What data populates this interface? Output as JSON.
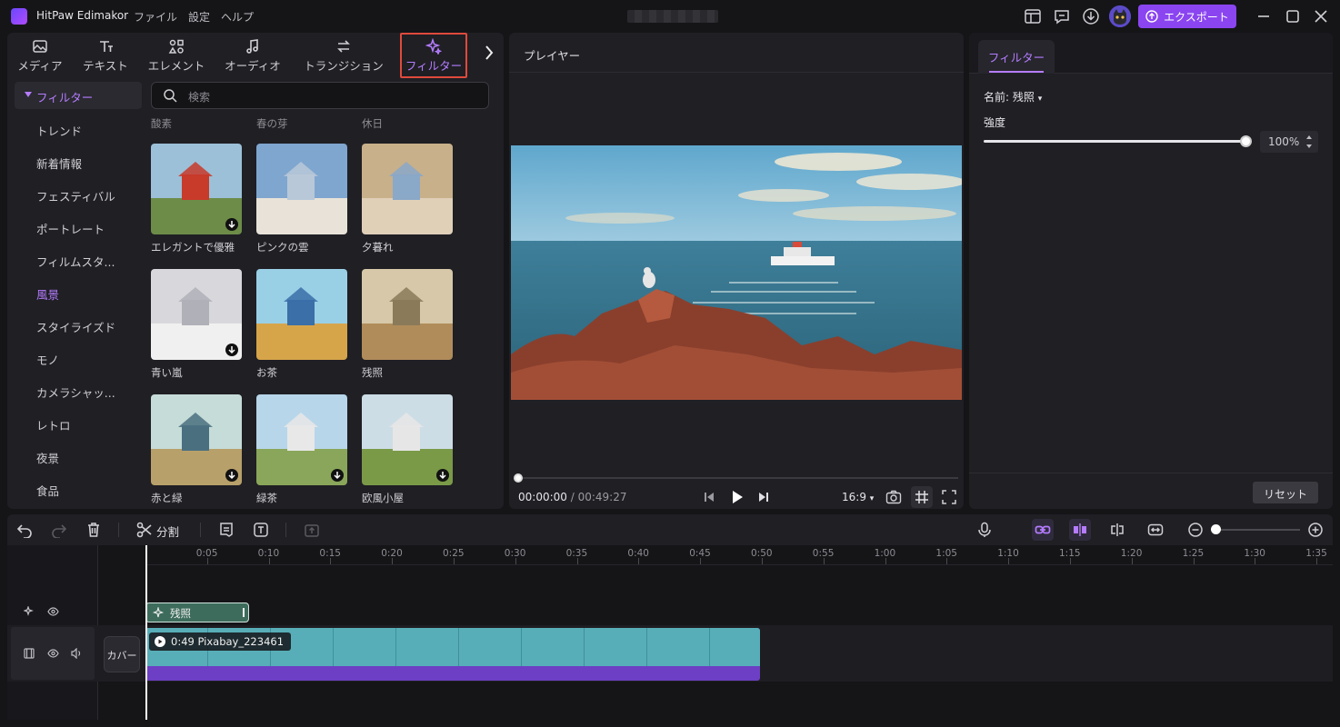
{
  "app": {
    "name": "HitPaw Edimakor",
    "menu": [
      "ファイル",
      "設定",
      "ヘルプ"
    ],
    "export_label": "エクスポート"
  },
  "icons": {
    "toolbar_right": [
      "layout-icon",
      "feedback-icon",
      "download-icon",
      "avatar-icon"
    ],
    "window": [
      "minimize-icon",
      "maximize-icon",
      "close-icon"
    ]
  },
  "left_tabs": [
    {
      "label": "メディア",
      "icon": "media-icon"
    },
    {
      "label": "テキスト",
      "icon": "text-icon"
    },
    {
      "label": "エレメント",
      "icon": "element-icon"
    },
    {
      "label": "オーディオ",
      "icon": "audio-icon"
    },
    {
      "label": "トランジション",
      "icon": "transition-icon"
    },
    {
      "label": "フィルター",
      "icon": "filter-icon",
      "active": true
    }
  ],
  "categories": {
    "header": "フィルター",
    "items": [
      "トレンド",
      "新着情報",
      "フェスティバル",
      "ポートレート",
      "フィルムスタ...",
      "風景",
      "スタイライズド",
      "モノ",
      "カメラシャッ...",
      "レトロ",
      "夜景",
      "食品"
    ],
    "active": "風景"
  },
  "search": {
    "placeholder": "検索"
  },
  "partial_row_labels": [
    "酸素",
    "春の芽",
    "休日"
  ],
  "filters": [
    {
      "label": "エレガントで優雅",
      "downloadable": true
    },
    {
      "label": "ピンクの雲",
      "downloadable": false
    },
    {
      "label": "夕暮れ",
      "downloadable": false
    },
    {
      "label": "青い嵐",
      "downloadable": true
    },
    {
      "label": "お茶",
      "downloadable": false
    },
    {
      "label": "残照",
      "downloadable": false
    },
    {
      "label": "赤と緑",
      "downloadable": true
    },
    {
      "label": "緑茶",
      "downloadable": true
    },
    {
      "label": "欧風小屋",
      "downloadable": true
    }
  ],
  "player": {
    "title": "プレイヤー",
    "current_time": "00:00:00",
    "total_time": "/ 00:49:27",
    "ratio": "16:9",
    "progress": 0
  },
  "properties": {
    "tab": "フィルター",
    "name_label": "名前:",
    "name_value": "残照",
    "strength_label": "強度",
    "strength_value": "100%",
    "strength": 1.0,
    "reset_label": "リセット"
  },
  "timeline_toolbar": {
    "split_label": "分割"
  },
  "timeline": {
    "ticks": [
      "0:05",
      "0:10",
      "0:15",
      "0:20",
      "0:25",
      "0:30",
      "0:35",
      "0:40",
      "0:45",
      "0:50",
      "0:55",
      "1:00",
      "1:05",
      "1:10",
      "1:15",
      "1:20",
      "1:25",
      "1:30",
      "1:35"
    ],
    "cover_label": "カバー",
    "filter_clip": "残照",
    "video_clip": "0:49 Pixabay_223461"
  },
  "colors": {
    "accent": "#b57cff",
    "export": "#8a45f0",
    "highlight_outline": "#e04a3c"
  }
}
